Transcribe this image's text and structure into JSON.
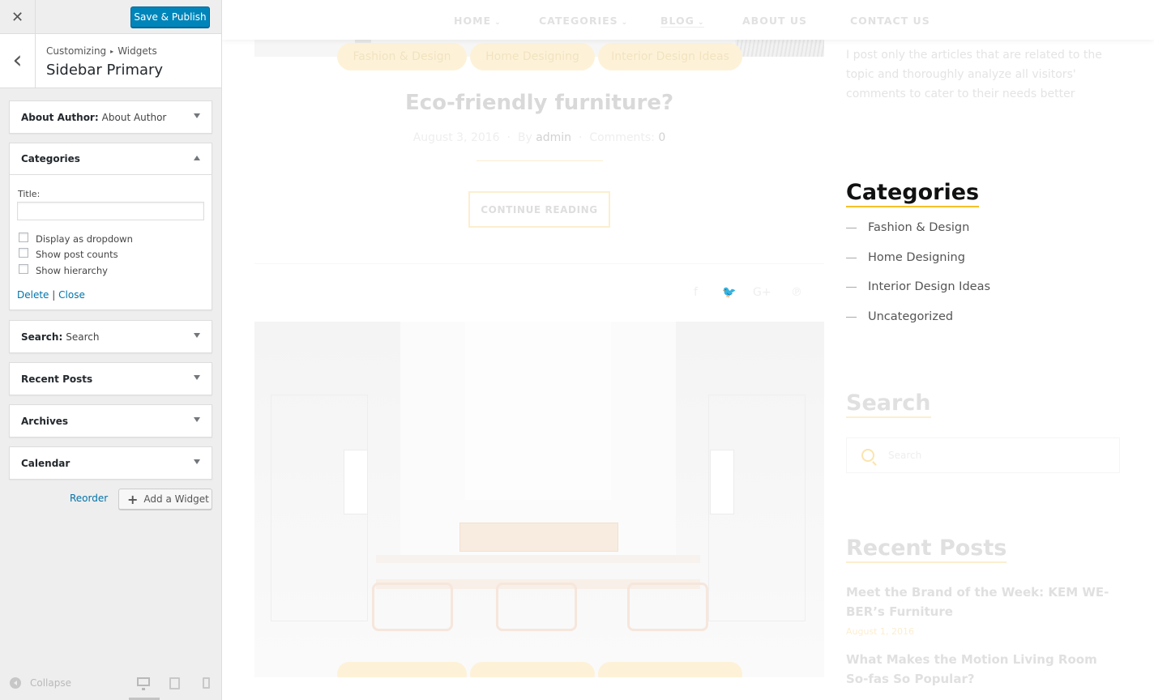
{
  "panel": {
    "close_glyph": "✕",
    "save_label": "Save & Publish",
    "back_glyph": "‹",
    "breadcrumb": {
      "root": "Customizing",
      "sep": "▸",
      "current": "Widgets"
    },
    "section_title": "Sidebar Primary",
    "widgets": [
      {
        "name": "About Author",
        "title": "About Author",
        "state": "collapsed"
      },
      {
        "name": "Categories",
        "title": "",
        "state": "expanded"
      },
      {
        "name": "Search",
        "title": "Search",
        "state": "collapsed"
      },
      {
        "name": "Recent Posts",
        "title": "",
        "state": "collapsed"
      },
      {
        "name": "Archives",
        "title": "",
        "state": "collapsed"
      },
      {
        "name": "Calendar",
        "title": "",
        "state": "collapsed"
      }
    ],
    "categories_form": {
      "title_label": "Title:",
      "title_value": "",
      "options": [
        {
          "label": "Display as dropdown",
          "checked": false
        },
        {
          "label": "Show post counts",
          "checked": false
        },
        {
          "label": "Show hierarchy",
          "checked": false
        }
      ],
      "delete_label": "Delete",
      "link_sep": "|",
      "close_label": "Close"
    },
    "reorder_label": "Reorder",
    "add_widget_label": "Add a Widget",
    "collapse_label": "Collapse",
    "devices": [
      "desktop-icon",
      "tablet-icon",
      "mobile-icon"
    ]
  },
  "preview": {
    "nav": [
      {
        "label": "HOME",
        "has_caret": true
      },
      {
        "label": "CATEGORIES",
        "has_caret": true
      },
      {
        "label": "BLOG",
        "has_caret": true
      },
      {
        "label": "ABOUT US",
        "has_caret": false
      },
      {
        "label": "CONTACT US",
        "has_caret": false
      }
    ],
    "caret": "⌄",
    "post": {
      "categories": [
        "Fashion & Design",
        "Home Designing",
        "Interior Design Ideas"
      ],
      "title": "Eco-friendly furniture?",
      "date": "August 3, 2016",
      "by_label": "By",
      "author": "admin",
      "comments_label": "Comments:",
      "comments_count": "0",
      "meta_sep": "·",
      "continue_label": "CONTINUE READING",
      "share_icons": [
        "f",
        "🐦",
        "G+",
        "℗"
      ]
    },
    "sidebar": {
      "about_text": "I post only the articles that are related to the topic and thoroughly analyze all visitors' comments to cater to their needs better",
      "categories_heading": "Categories",
      "categories": [
        "Fashion & Design",
        "Home Designing",
        "Interior Design Ideas",
        "Uncategorized"
      ],
      "search_heading": "Search",
      "search_placeholder": "Search",
      "recent_heading": "Recent Posts",
      "recent_posts": [
        {
          "title": "Meet the Brand of the Week: KEM WE-BER’s Furniture",
          "date": "August 1, 2016"
        },
        {
          "title": "What Makes the Motion Living Room So-fas So Popular?",
          "date": ""
        }
      ]
    }
  },
  "colors": {
    "primary": "#0085ba",
    "link": "#0073aa",
    "accent": "#f5c12b"
  }
}
